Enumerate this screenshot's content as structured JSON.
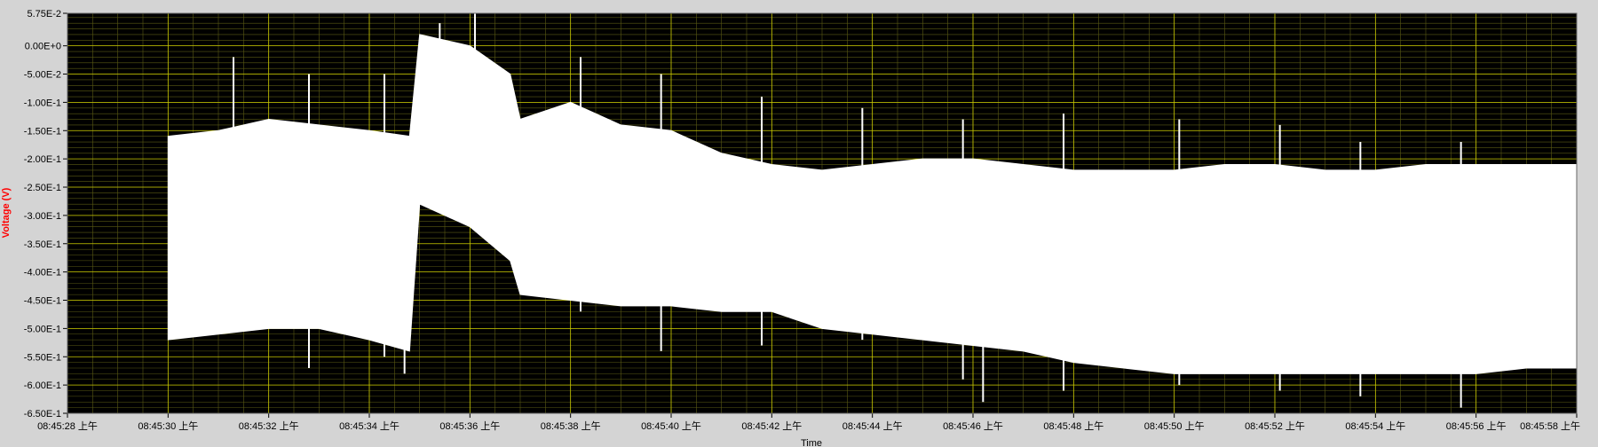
{
  "colors": {
    "frame_bg": "#d4d4d4",
    "plot_bg": "#000000",
    "grid_major": "#c8c800",
    "grid_minor": "#5a5a14",
    "trace": "#ffffff",
    "ylabel": "#ff0000"
  },
  "chart_data": {
    "type": "line",
    "xlabel": "Time",
    "ylabel": "Voltage (V)",
    "ylim": [
      -0.65,
      0.0575
    ],
    "xlim": [
      "08:45:28",
      "08:45:58"
    ],
    "grid": true,
    "legend": "none",
    "yticks": [
      {
        "value": 0.0575,
        "label": "5.75E-2"
      },
      {
        "value": 0.0,
        "label": "0.00E+0"
      },
      {
        "value": -0.05,
        "label": "-5.00E-2"
      },
      {
        "value": -0.1,
        "label": "-1.00E-1"
      },
      {
        "value": -0.15,
        "label": "-1.50E-1"
      },
      {
        "value": -0.2,
        "label": "-2.00E-1"
      },
      {
        "value": -0.25,
        "label": "-2.50E-1"
      },
      {
        "value": -0.3,
        "label": "-3.00E-1"
      },
      {
        "value": -0.35,
        "label": "-3.50E-1"
      },
      {
        "value": -0.4,
        "label": "-4.00E-1"
      },
      {
        "value": -0.45,
        "label": "-4.50E-1"
      },
      {
        "value": -0.5,
        "label": "-5.00E-1"
      },
      {
        "value": -0.55,
        "label": "-5.50E-1"
      },
      {
        "value": -0.6,
        "label": "-6.00E-1"
      },
      {
        "value": -0.65,
        "label": "-6.50E-1"
      }
    ],
    "xticks": [
      {
        "value": "08:45:28",
        "label": "08:45:28 上午"
      },
      {
        "value": "08:45:30",
        "label": "08:45:30 上午"
      },
      {
        "value": "08:45:32",
        "label": "08:45:32 上午"
      },
      {
        "value": "08:45:34",
        "label": "08:45:34 上午"
      },
      {
        "value": "08:45:36",
        "label": "08:45:36 上午"
      },
      {
        "value": "08:45:38",
        "label": "08:45:38 上午"
      },
      {
        "value": "08:45:40",
        "label": "08:45:40 上午"
      },
      {
        "value": "08:45:42",
        "label": "08:45:42 上午"
      },
      {
        "value": "08:45:44",
        "label": "08:45:44 上午"
      },
      {
        "value": "08:45:46",
        "label": "08:45:46 上午"
      },
      {
        "value": "08:45:48",
        "label": "08:45:48 上午"
      },
      {
        "value": "08:45:50",
        "label": "08:45:50 上午"
      },
      {
        "value": "08:45:52",
        "label": "08:45:52 上午"
      },
      {
        "value": "08:45:54",
        "label": "08:45:54 上午"
      },
      {
        "value": "08:45:56",
        "label": "08:45:56 上午"
      },
      {
        "value": "08:45:58",
        "label": "08:45:58 上午"
      }
    ],
    "series": [
      {
        "style": "filled min-max envelope",
        "x": [
          "08:45:30",
          "08:45:31",
          "08:45:32",
          "08:45:33",
          "08:45:34",
          "08:45:34.8",
          "08:45:35",
          "08:45:36",
          "08:45:36.8",
          "08:45:37",
          "08:45:38",
          "08:45:39",
          "08:45:40",
          "08:45:41",
          "08:45:42",
          "08:45:43",
          "08:45:44",
          "08:45:45",
          "08:45:46",
          "08:45:47",
          "08:45:48",
          "08:45:49",
          "08:45:50",
          "08:45:51",
          "08:45:52",
          "08:45:53",
          "08:45:54",
          "08:45:55",
          "08:45:56",
          "08:45:57",
          "08:45:58"
        ],
        "upper": [
          -0.16,
          -0.15,
          -0.13,
          -0.14,
          -0.15,
          -0.16,
          0.02,
          0.0,
          -0.05,
          -0.13,
          -0.1,
          -0.14,
          -0.15,
          -0.19,
          -0.21,
          -0.22,
          -0.21,
          -0.2,
          -0.2,
          -0.21,
          -0.22,
          -0.22,
          -0.22,
          -0.21,
          -0.21,
          -0.22,
          -0.22,
          -0.21,
          -0.21,
          -0.21,
          -0.21
        ],
        "lower": [
          -0.52,
          -0.51,
          -0.5,
          -0.5,
          -0.52,
          -0.54,
          -0.28,
          -0.32,
          -0.38,
          -0.44,
          -0.45,
          -0.46,
          -0.46,
          -0.47,
          -0.47,
          -0.5,
          -0.51,
          -0.52,
          -0.53,
          -0.54,
          -0.56,
          -0.57,
          -0.58,
          -0.58,
          -0.58,
          -0.58,
          -0.58,
          -0.58,
          -0.58,
          -0.57,
          -0.57
        ]
      }
    ],
    "spikes": [
      {
        "x": "08:45:31.3",
        "max": -0.02,
        "min": -0.43
      },
      {
        "x": "08:45:32.8",
        "max": -0.05,
        "min": -0.57
      },
      {
        "x": "08:45:34.3",
        "max": -0.05,
        "min": -0.55
      },
      {
        "x": "08:45:34.7",
        "max": -0.25,
        "min": -0.58
      },
      {
        "x": "08:45:35.4",
        "max": 0.04,
        "min": -0.27
      },
      {
        "x": "08:45:36.1",
        "max": 0.057,
        "min": -0.28
      },
      {
        "x": "08:45:38.2",
        "max": -0.02,
        "min": -0.47
      },
      {
        "x": "08:45:39.8",
        "max": -0.05,
        "min": -0.54
      },
      {
        "x": "08:45:41.8",
        "max": -0.09,
        "min": -0.53
      },
      {
        "x": "08:45:43.8",
        "max": -0.11,
        "min": -0.52
      },
      {
        "x": "08:45:45.8",
        "max": -0.13,
        "min": -0.59
      },
      {
        "x": "08:45:46.2",
        "max": -0.23,
        "min": -0.63
      },
      {
        "x": "08:45:47.8",
        "max": -0.12,
        "min": -0.61
      },
      {
        "x": "08:45:50.1",
        "max": -0.13,
        "min": -0.6
      },
      {
        "x": "08:45:52.1",
        "max": -0.14,
        "min": -0.61
      },
      {
        "x": "08:45:53.7",
        "max": -0.17,
        "min": -0.62
      },
      {
        "x": "08:45:55.7",
        "max": -0.17,
        "min": -0.64
      }
    ]
  }
}
